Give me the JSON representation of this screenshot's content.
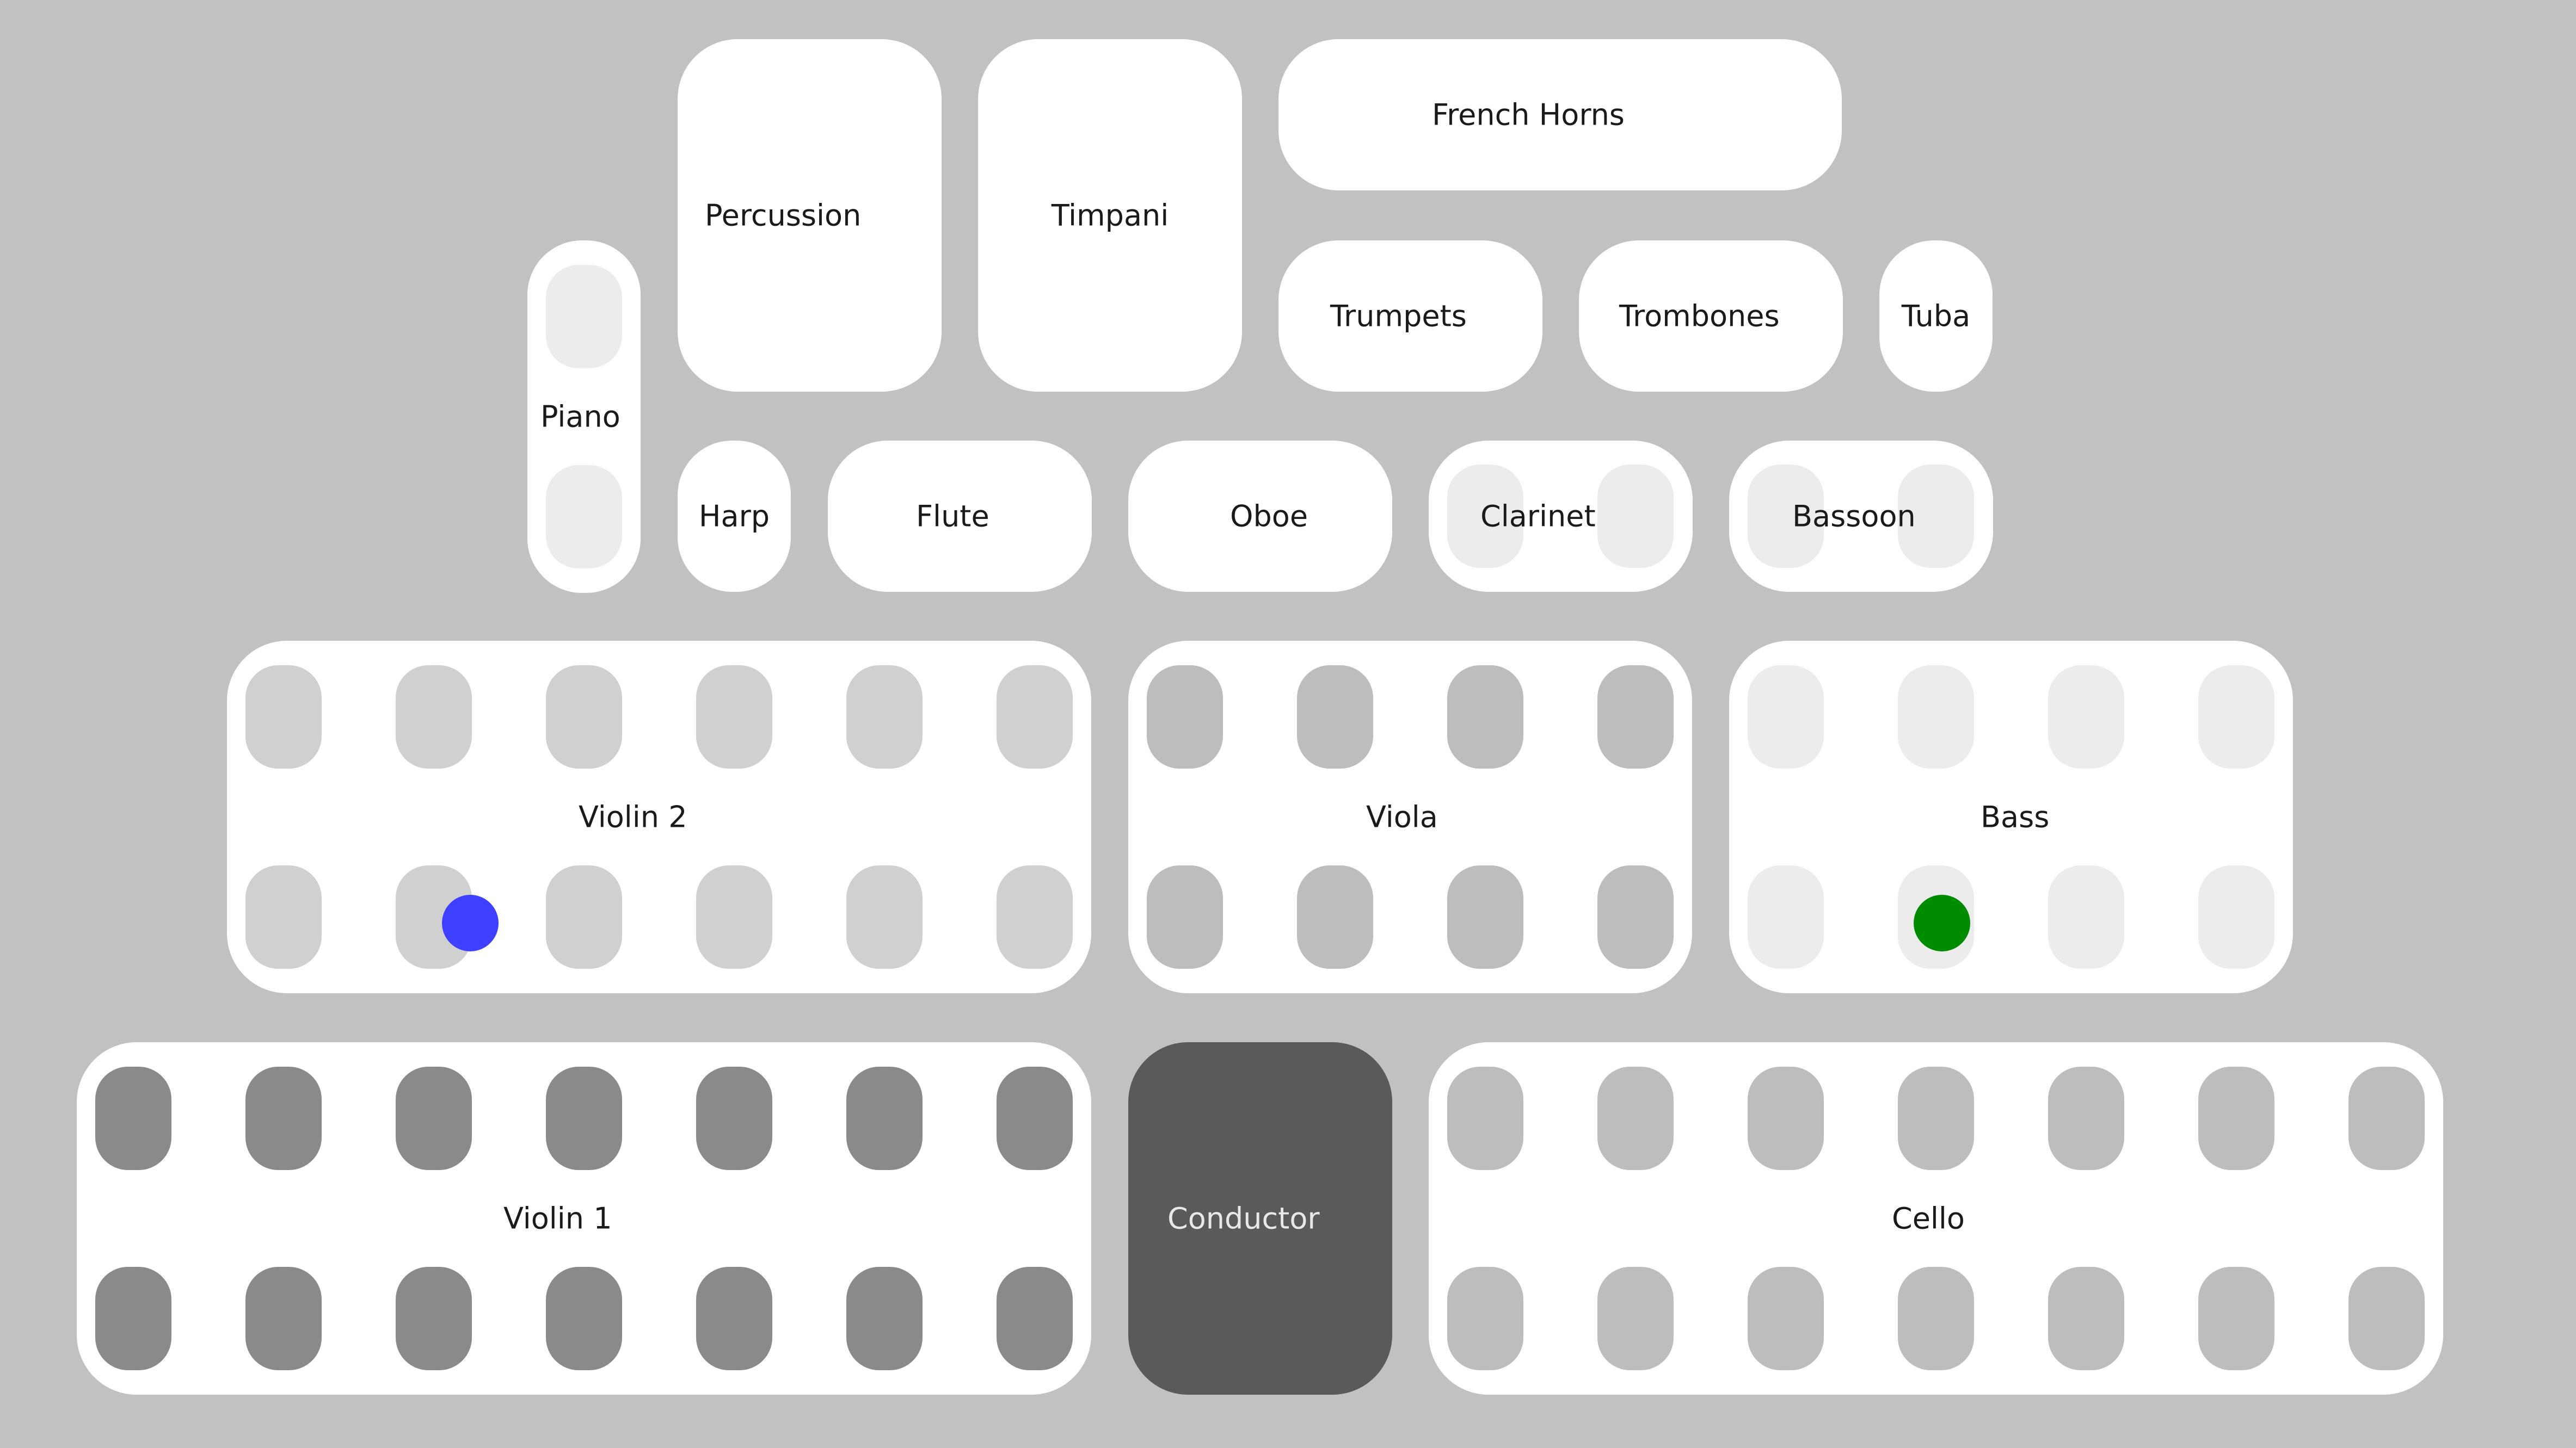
{
  "colors": {
    "background": "#c1c1c1",
    "section_fill": "#ffffff",
    "conductor_fill": "#5a5a5a",
    "conductor_text": "#e8e8e8",
    "seat_violin1": "#8a8a8a",
    "seat_violin2": "#d0d0d0",
    "seat_viola": "#bdbdbd",
    "seat_cello": "#bdbdbd",
    "seat_bass": "#ececec",
    "seat_piano": "#ececec",
    "seat_winds": "#ececec",
    "marker_blue": "#3f3fff",
    "marker_green": "#008c00"
  },
  "sections": {
    "percussion": "Percussion",
    "timpani": "Timpani",
    "french_horns": "French Horns",
    "trumpets": "Trumpets",
    "trombones": "Trombones",
    "tuba": "Tuba",
    "piano": "Piano",
    "harp": "Harp",
    "flute": "Flute",
    "oboe": "Oboe",
    "clarinet": "Clarinet",
    "bassoon": "Bassoon",
    "violin2": "Violin 2",
    "viola": "Viola",
    "bass": "Bass",
    "violin1": "Violin 1",
    "conductor": "Conductor",
    "cello": "Cello"
  },
  "markers": [
    {
      "name": "player-marker-blue",
      "section": "Violin 2",
      "row": 2,
      "seat": 2,
      "color": "blue"
    },
    {
      "name": "player-marker-green",
      "section": "Bass",
      "row": 2,
      "seat": 2,
      "color": "green"
    }
  ]
}
